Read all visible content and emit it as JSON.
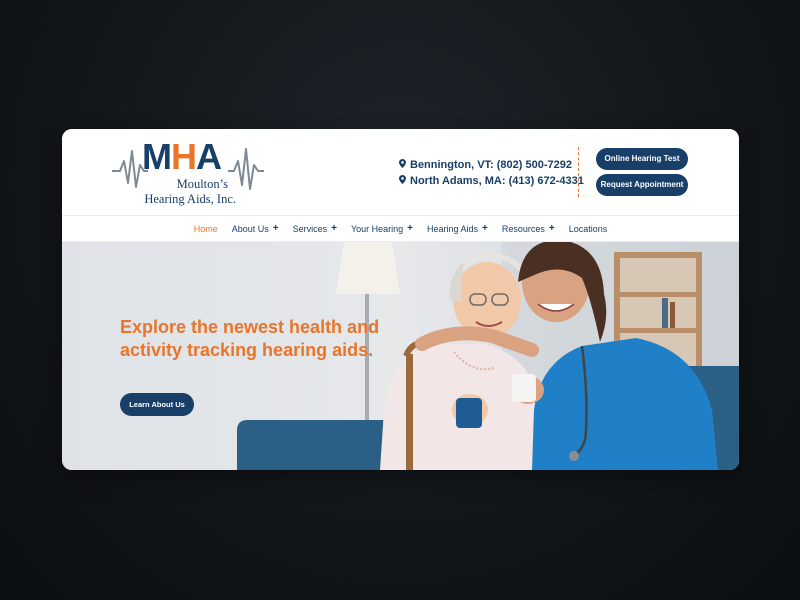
{
  "logo": {
    "monogram_m": "M",
    "monogram_h": "H",
    "monogram_a": "A",
    "line1": "Moulton’s",
    "line2": "Hearing Aids, Inc."
  },
  "contact": [
    {
      "text": "Bennington, VT: (802) 500-7292",
      "icon": "map-pin-icon"
    },
    {
      "text": "North Adams, MA: (413) 672-4331",
      "icon": "map-pin-icon"
    }
  ],
  "buttons": {
    "online_test": "Online Hearing Test",
    "request_appointment": "Request Appointment"
  },
  "nav": [
    {
      "label": "Home",
      "active": true,
      "has_submenu": false
    },
    {
      "label": "About Us",
      "active": false,
      "has_submenu": true
    },
    {
      "label": "Services",
      "active": false,
      "has_submenu": true
    },
    {
      "label": "Your Hearing",
      "active": false,
      "has_submenu": true
    },
    {
      "label": "Hearing Aids",
      "active": false,
      "has_submenu": true
    },
    {
      "label": "Resources",
      "active": false,
      "has_submenu": true
    },
    {
      "label": "Locations",
      "active": false,
      "has_submenu": false
    }
  ],
  "nav_submenu_glyph": "+",
  "hero": {
    "heading": "Explore the newest health and activity tracking hearing aids.",
    "button": "Learn About Us",
    "image": "photo-elderly-woman-and-nurse-smiling"
  },
  "colors": {
    "navy": "#173f68",
    "orange": "#e8752a",
    "page_bg": "#121619"
  }
}
